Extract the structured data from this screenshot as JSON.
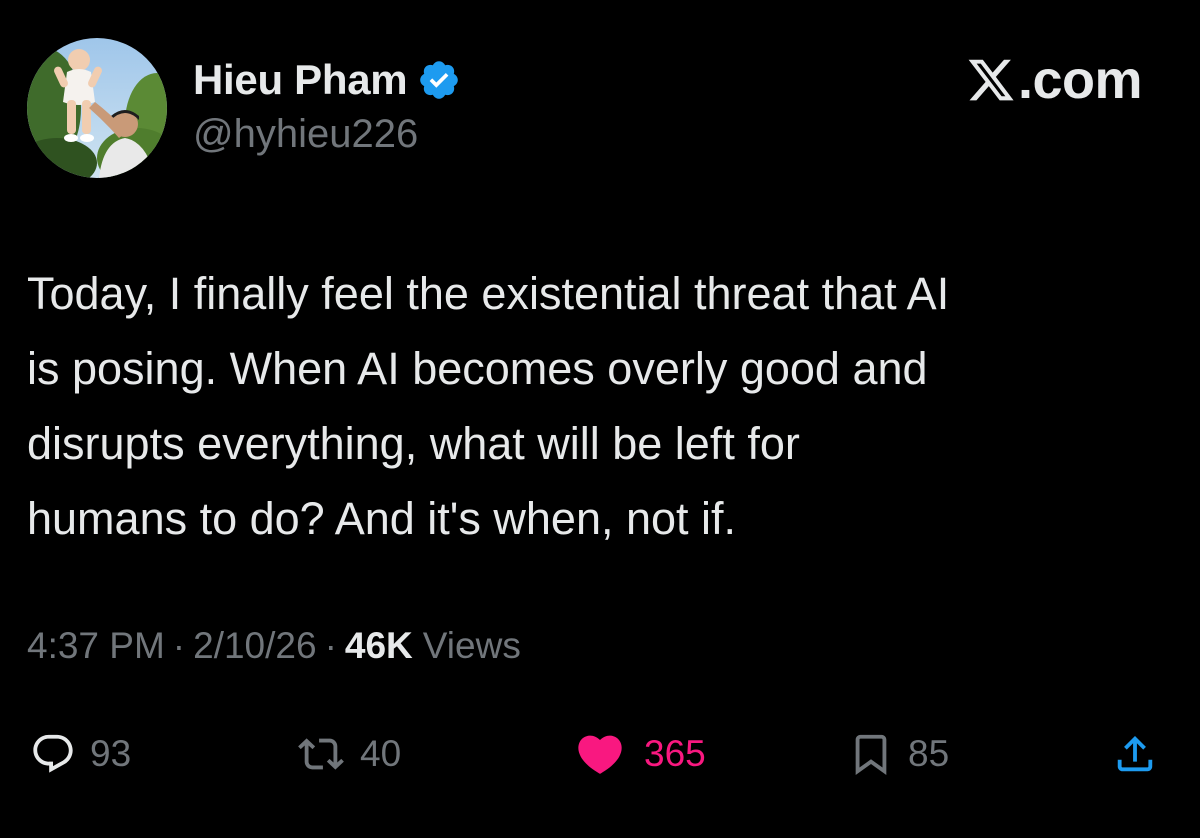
{
  "author": {
    "display_name": "Hieu Pham",
    "handle": "@hyhieu226",
    "verified": true,
    "avatar_icon": "profile-photo-avatar"
  },
  "brand": {
    "label": ".com",
    "icon": "x-logo-icon"
  },
  "tweet": {
    "text": "Today, I finally feel the existential threat that AI\nis posing. When AI becomes overly good and\ndisrupts everything, what will be left for\nhumans to do? And it's when, not if.",
    "time": "4:37 PM",
    "date": "2/10/26",
    "views_count": "46K",
    "views_label": "Views",
    "separator": "·"
  },
  "actions": {
    "replies": "93",
    "reposts": "40",
    "likes": "365",
    "bookmarks": "85"
  },
  "colors": {
    "background": "#000000",
    "primary_text": "#e7e9ea",
    "secondary_text": "#71767b",
    "verified_blue": "#1d9bf0",
    "like_pink": "#f91880"
  }
}
